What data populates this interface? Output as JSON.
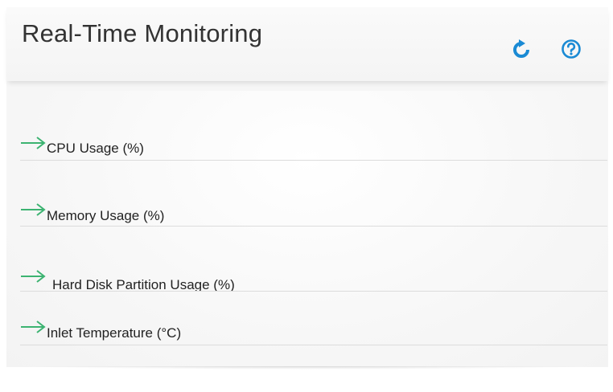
{
  "header": {
    "title": "Real-Time Monitoring",
    "refresh_icon": "refresh-icon",
    "help_icon": "help-icon"
  },
  "colors": {
    "accent": "#1a8ad4",
    "arrow": "#3cb371",
    "title": "#333333"
  },
  "items": [
    {
      "label": "CPU Usage (%)",
      "icon": "arrow-right-icon"
    },
    {
      "label": "Memory Usage (%)",
      "icon": "arrow-right-icon"
    },
    {
      "label": "Hard Disk Partition Usage (%)",
      "icon": "arrow-right-icon"
    },
    {
      "label": "Inlet Temperature (°C)",
      "icon": "arrow-right-icon"
    }
  ]
}
